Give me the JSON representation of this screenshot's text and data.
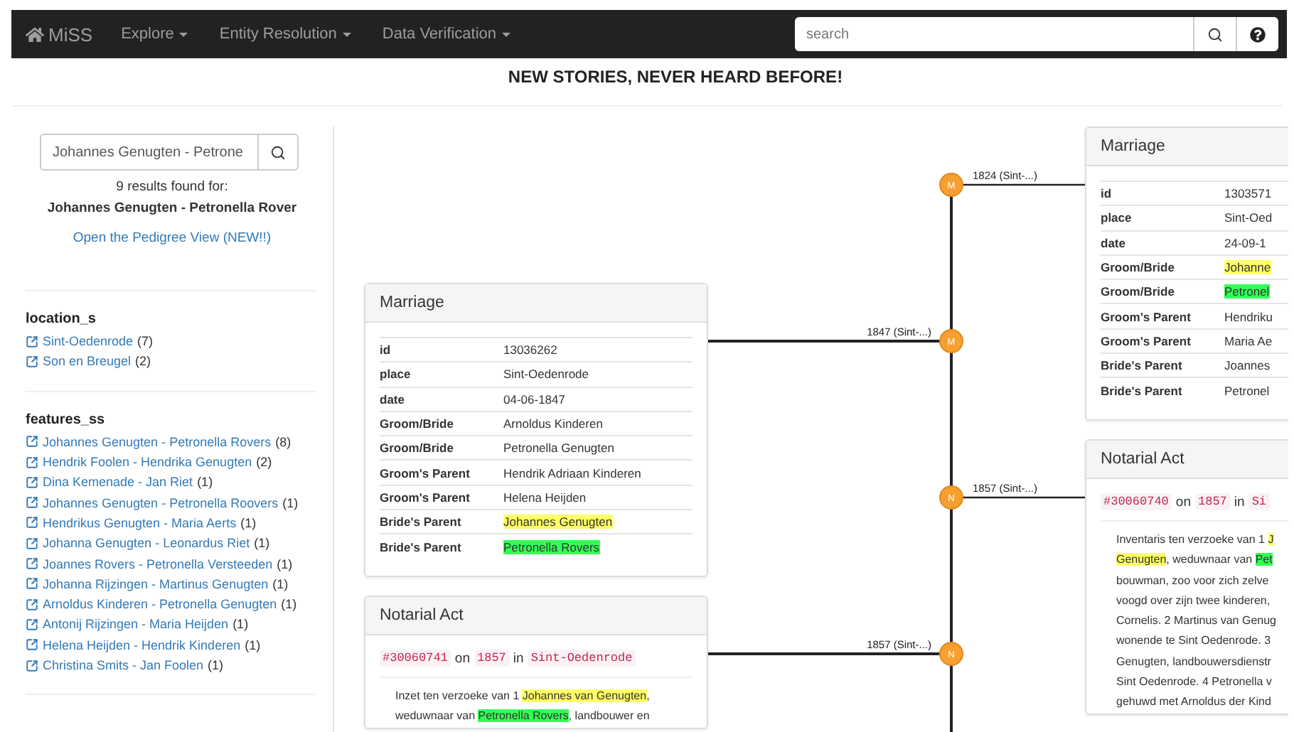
{
  "navbar": {
    "brand": "MiSS",
    "menus": [
      {
        "label": "Explore"
      },
      {
        "label": "Entity Resolution"
      },
      {
        "label": "Data Verification"
      }
    ],
    "search": {
      "placeholder": "search"
    }
  },
  "headline": "NEW STORIES, NEVER HEARD BEFORE!",
  "sidebar": {
    "search": {
      "value": "Johannes Genugten - Petrone"
    },
    "results_text": "9 results found for:",
    "query": "Johannes Genugten - Petronella Rover",
    "pedigree_link": "Open the Pedigree View (NEW!!)",
    "facets": [
      {
        "title": "location_s",
        "items": [
          {
            "label": "Sint-Oedenrode",
            "count": "(7)"
          },
          {
            "label": "Son en Breugel",
            "count": "(2)"
          }
        ]
      },
      {
        "title": "features_ss",
        "items": [
          {
            "label": "Johannes Genugten - Petronella Rovers",
            "count": "(8)"
          },
          {
            "label": "Hendrik Foolen - Hendrika Genugten",
            "count": "(2)"
          },
          {
            "label": "Dina Kemenade - Jan Riet",
            "count": "(1)"
          },
          {
            "label": "Johannes Genugten - Petronella Roovers",
            "count": "(1)"
          },
          {
            "label": "Hendrikus Genugten - Maria Aerts",
            "count": "(1)"
          },
          {
            "label": "Johanna Genugten - Leonardus Riet",
            "count": "(1)"
          },
          {
            "label": "Joannes Rovers - Petronella Versteeden",
            "count": "(1)"
          },
          {
            "label": "Johanna Rijzingen - Martinus Genugten",
            "count": "(1)"
          },
          {
            "label": "Arnoldus Kinderen - Petronella Genugten",
            "count": "(1)"
          },
          {
            "label": "Antonij Rijzingen - Maria Heijden",
            "count": "(1)"
          },
          {
            "label": "Helena Heijden - Hendrik Kinderen",
            "count": "(1)"
          },
          {
            "label": "Christina Smits - Jan Foolen",
            "count": "(1)"
          }
        ]
      }
    ]
  },
  "timeline": {
    "events": [
      {
        "marker": "M",
        "label": "1824 (Sint-...)",
        "card": {
          "kind": "table",
          "title": "Marriage",
          "rows": [
            {
              "label": "id",
              "value": "1303571"
            },
            {
              "label": "place",
              "value": "Sint-Oed"
            },
            {
              "label": "date",
              "value": "24-09-1"
            },
            {
              "label": "Groom/Bride",
              "value": "Johanne",
              "color": "#ffff66"
            },
            {
              "label": "Groom/Bride",
              "value": "Petronel",
              "color": "#33ff55"
            },
            {
              "label": "Groom's Parent",
              "value": "Hendriku"
            },
            {
              "label": "Groom's Parent",
              "value": "Maria Ae"
            },
            {
              "label": "Bride's Parent",
              "value": "Joannes"
            },
            {
              "label": "Bride's Parent",
              "value": "Petronel"
            }
          ]
        }
      },
      {
        "marker": "M",
        "label": "1847 (Sint-...)",
        "card": {
          "kind": "table",
          "title": "Marriage",
          "rows": [
            {
              "label": "id",
              "value": "13036262"
            },
            {
              "label": "place",
              "value": "Sint-Oedenrode"
            },
            {
              "label": "date",
              "value": "04-06-1847"
            },
            {
              "label": "Groom/Bride",
              "value": "Arnoldus Kinderen"
            },
            {
              "label": "Groom/Bride",
              "value": "Petronella Genugten"
            },
            {
              "label": "Groom's Parent",
              "value": "Hendrik Adriaan Kinderen"
            },
            {
              "label": "Groom's Parent",
              "value": "Helena Heijden"
            },
            {
              "label": "Bride's Parent",
              "value": "Johannes Genugten",
              "color": "#ffff66"
            },
            {
              "label": "Bride's Parent",
              "value": "Petronella Rovers",
              "color": "#33ff55"
            }
          ]
        }
      },
      {
        "marker": "N",
        "label": "1857 (Sint-...)",
        "card": {
          "kind": "act",
          "title": "Notarial Act",
          "ref": [
            {
              "text": "#30060740",
              "kind": "code"
            },
            {
              "text": "on",
              "kind": "plain"
            },
            {
              "text": "1857",
              "kind": "code"
            },
            {
              "text": "in",
              "kind": "plain"
            },
            {
              "text": "Si",
              "kind": "code"
            }
          ],
          "lines": [
            [
              {
                "text": "Inventaris ten verzoeke van 1 "
              },
              {
                "text": "J",
                "color": "#ffff66"
              }
            ],
            [
              {
                "text": "Genugten",
                "color": "#ffff66"
              },
              {
                "text": ", weduwnaar van "
              },
              {
                "text": "Pet",
                "color": "#33ff55"
              }
            ],
            [
              {
                "text": "bouwman, zoo voor zich zelve"
              }
            ],
            [
              {
                "text": "voogd over zijn twee kinderen,"
              }
            ],
            [
              {
                "text": "Cornelis. 2 Martinus van Genug"
              }
            ],
            [
              {
                "text": "wonende te Sint Oedenrode. 3"
              }
            ],
            [
              {
                "text": "Genugten, landbouwersdienstr"
              }
            ],
            [
              {
                "text": "Sint Oedenrode. 4 Petronella v"
              }
            ],
            [
              {
                "text": "gehuwd met Arnoldus der Kind"
              }
            ]
          ]
        }
      },
      {
        "marker": "N",
        "label": "1857 (Sint-...)",
        "card": {
          "kind": "act",
          "title": "Notarial Act",
          "ref": [
            {
              "text": "#30060741",
              "kind": "code"
            },
            {
              "text": "on",
              "kind": "plain"
            },
            {
              "text": "1857",
              "kind": "code"
            },
            {
              "text": "in",
              "kind": "plain"
            },
            {
              "text": "Sint-Oedenrode",
              "kind": "code"
            }
          ],
          "lines": [
            [
              {
                "text": "Inzet ten verzoeke van 1 "
              },
              {
                "text": "Johannes van Genugten",
                "color": "#ffff66"
              },
              {
                "text": ","
              }
            ],
            [
              {
                "text": "weduwnaar van "
              },
              {
                "text": "Petronella Rovers",
                "color": "#33ff55"
              },
              {
                "text": ", landbouwer en"
              }
            ]
          ]
        }
      }
    ]
  }
}
